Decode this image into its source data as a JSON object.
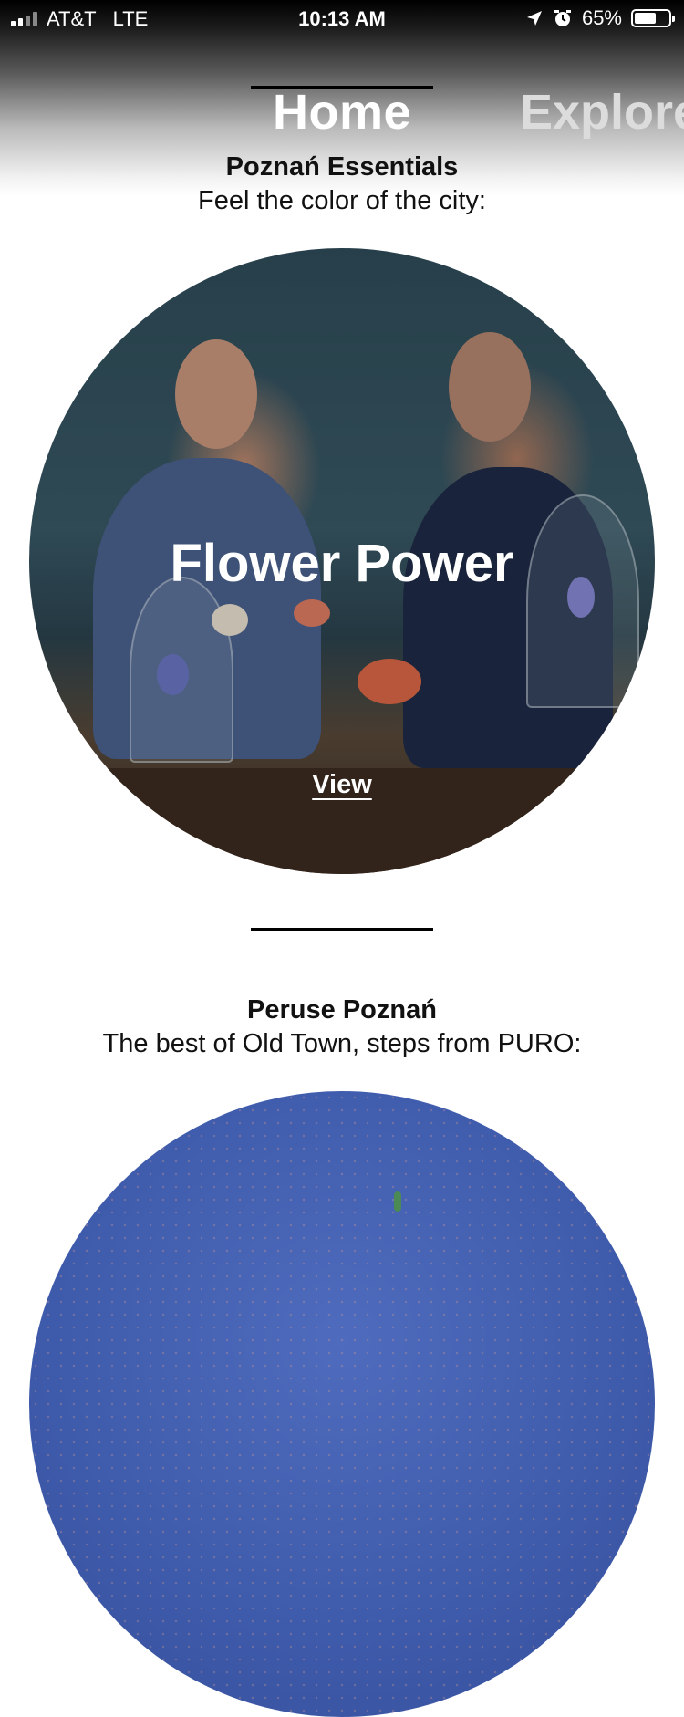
{
  "status_bar": {
    "carrier": "AT&T",
    "network": "LTE",
    "time": "10:13 AM",
    "battery_percent": "65%",
    "battery_level": 0.65,
    "icons": [
      "signal-icon",
      "location-arrow-icon",
      "alarm-icon",
      "battery-icon"
    ]
  },
  "tabs": [
    {
      "label": "Home",
      "active": true
    },
    {
      "label": "Explore",
      "active": false
    }
  ],
  "sections": [
    {
      "title": "Poznań Essentials",
      "subtitle": "Feel the color of the city:",
      "card": {
        "title": "Flower Power",
        "link": "View"
      }
    },
    {
      "title": "Peruse Poznań",
      "subtitle": "The best of Old Town, steps from PURO:"
    }
  ],
  "colors": {
    "accent": "#000000",
    "card_1_bg": "#304e5b",
    "card_2_bg": "#3e5aaa"
  }
}
